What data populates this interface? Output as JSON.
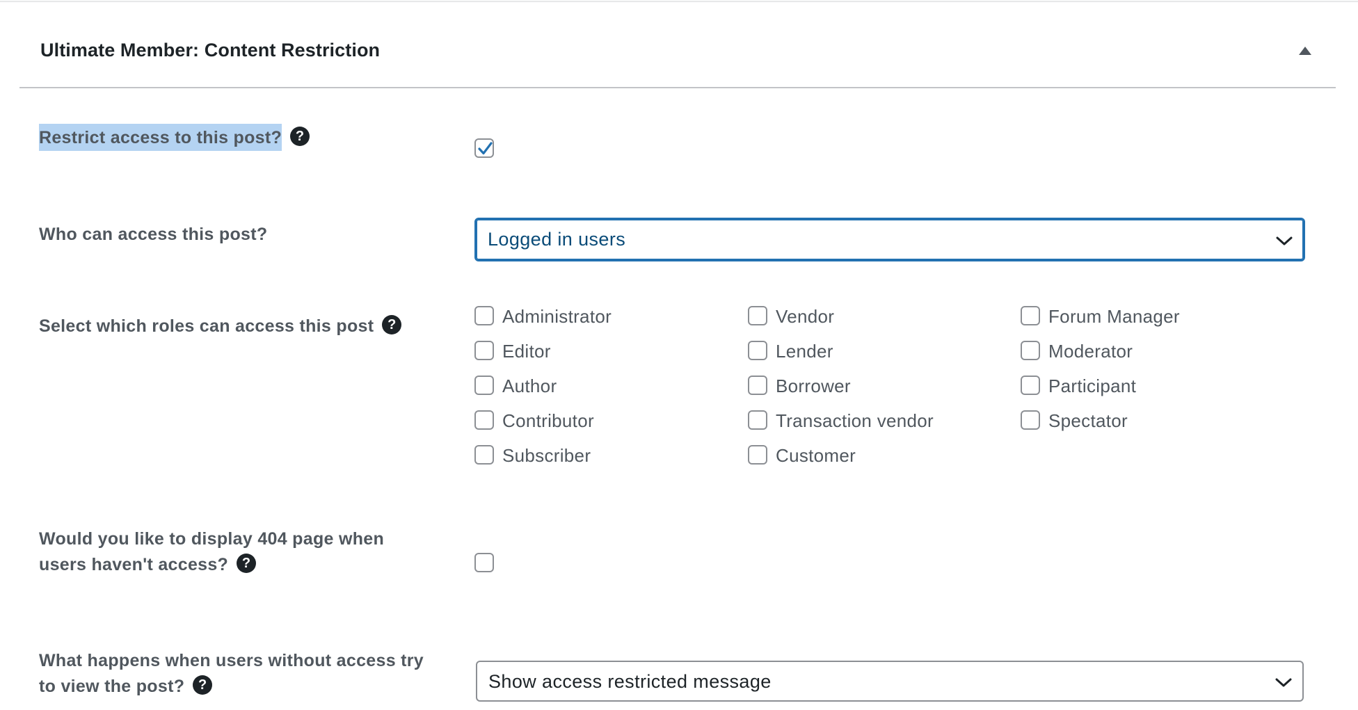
{
  "panel": {
    "title": "Ultimate Member: Content Restriction",
    "collapse_icon": "triangle-up-icon"
  },
  "restrict": {
    "label": "Restrict access to this post?",
    "checked": true
  },
  "who_access": {
    "label": "Who can access this post?",
    "selected": "Logged in users"
  },
  "roles": {
    "label": "Select which roles can access this post",
    "columns": [
      [
        {
          "label": "Administrator",
          "checked": false
        },
        {
          "label": "Editor",
          "checked": false
        },
        {
          "label": "Author",
          "checked": false
        },
        {
          "label": "Contributor",
          "checked": false
        },
        {
          "label": "Subscriber",
          "checked": false
        }
      ],
      [
        {
          "label": "Vendor",
          "checked": false
        },
        {
          "label": "Lender",
          "checked": false
        },
        {
          "label": "Borrower",
          "checked": false
        },
        {
          "label": "Transaction vendor",
          "checked": false
        },
        {
          "label": "Customer",
          "checked": false
        }
      ],
      [
        {
          "label": "Forum Manager",
          "checked": false
        },
        {
          "label": "Moderator",
          "checked": false
        },
        {
          "label": "Participant",
          "checked": false
        },
        {
          "label": "Spectator",
          "checked": false
        }
      ]
    ]
  },
  "page404": {
    "label_line1": "Would you like to display 404 page when",
    "label_line2": "users haven't access?",
    "checked": false
  },
  "no_access_action": {
    "label_line1": "What happens when users without access try",
    "label_line2": "to view the post?",
    "selected": "Show access restricted message"
  },
  "help_glyph": "?",
  "colors": {
    "accent": "#2271b1",
    "selection_highlight": "#b4d3f2",
    "text": "#50575e"
  }
}
